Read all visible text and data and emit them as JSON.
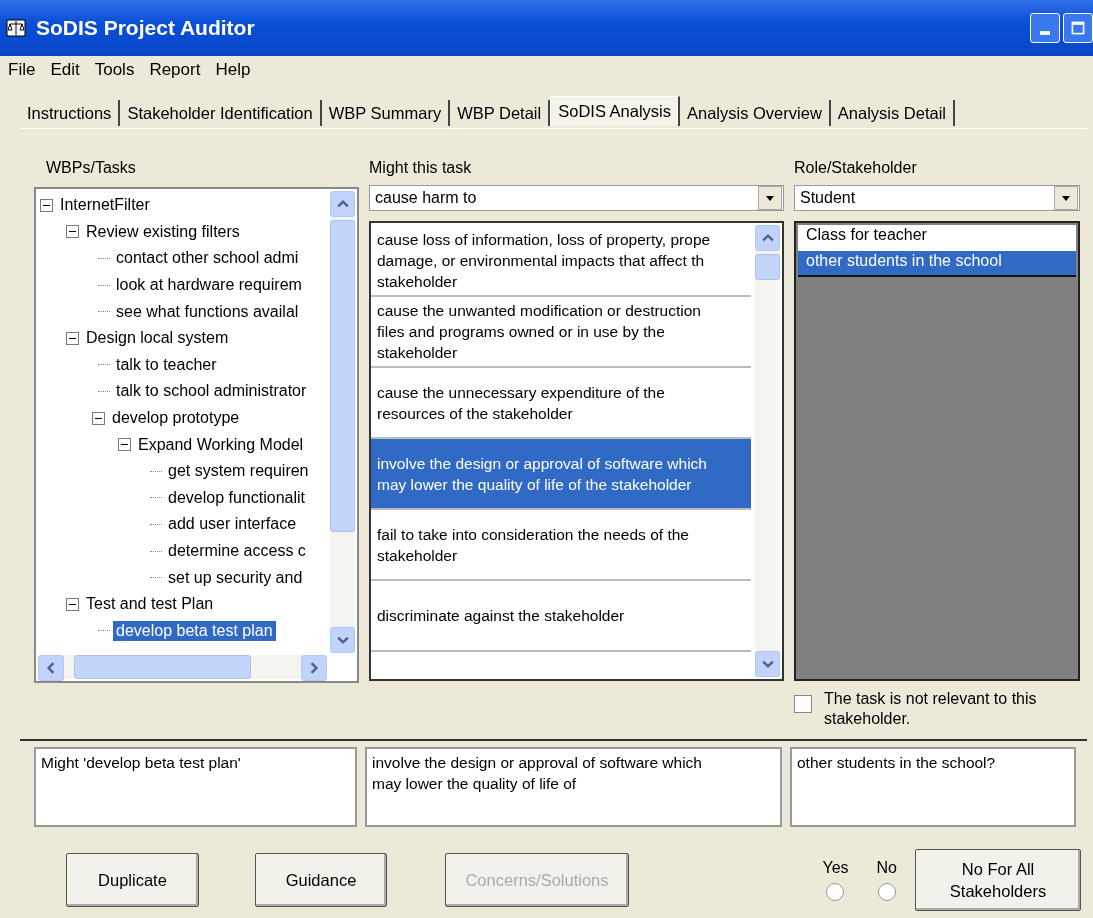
{
  "window": {
    "title": "SoDIS Project Auditor"
  },
  "menu": [
    "File",
    "Edit",
    "Tools",
    "Report",
    "Help"
  ],
  "tabs": [
    {
      "label": "Instructions",
      "selected": false
    },
    {
      "label": "Stakeholder Identification",
      "selected": false
    },
    {
      "label": "WBP Summary",
      "selected": false
    },
    {
      "label": "WBP Detail",
      "selected": false
    },
    {
      "label": "SoDIS Analysis",
      "selected": true
    },
    {
      "label": "Analysis Overview",
      "selected": false
    },
    {
      "label": "Analysis Detail",
      "selected": false
    }
  ],
  "tree": {
    "label": "WBPs/Tasks",
    "items": [
      {
        "label": "InternetFilter",
        "selected": false,
        "expanded": true,
        "children": [
          {
            "label": "Review existing filters",
            "selected": false,
            "expanded": true,
            "children": [
              {
                "label": "contact other school admi",
                "selected": false
              },
              {
                "label": "look at hardware requirem",
                "selected": false
              },
              {
                "label": "see what functions availal",
                "selected": false
              }
            ]
          },
          {
            "label": "Design local system",
            "selected": false,
            "expanded": true,
            "children": [
              {
                "label": "talk to teacher",
                "selected": false
              },
              {
                "label": "talk to school administrator",
                "selected": false
              },
              {
                "label": "develop prototype",
                "selected": false,
                "expanded": true,
                "children": [
                  {
                    "label": "Expand Working Model",
                    "selected": false,
                    "expanded": true,
                    "children": [
                      {
                        "label": "get system requiren",
                        "selected": false
                      },
                      {
                        "label": "develop functionalit",
                        "selected": false
                      },
                      {
                        "label": "add user interface",
                        "selected": false
                      },
                      {
                        "label": "determine access c",
                        "selected": false
                      },
                      {
                        "label": "set up security and",
                        "selected": false
                      }
                    ]
                  }
                ]
              }
            ]
          },
          {
            "label": "Test  and test Plan",
            "selected": false,
            "expanded": true,
            "children": [
              {
                "label": "develop beta test plan",
                "selected": true
              }
            ]
          }
        ]
      }
    ]
  },
  "harm": {
    "label": "Might this task",
    "value": "cause harm to",
    "items": [
      {
        "lines": [
          "cause loss of information, loss of property, prope",
          "damage, or environmental impacts that affect th",
          "stakeholder"
        ],
        "selected": false
      },
      {
        "lines": [
          "cause the unwanted modification or destruction",
          "files and programs owned or in use by the",
          "stakeholder"
        ],
        "selected": false
      },
      {
        "lines": [
          "cause the unnecessary expenditure of the",
          "resources of the stakeholder"
        ],
        "selected": false
      },
      {
        "lines": [
          "involve the design or approval of software which",
          "may lower the quality of life of the stakeholder"
        ],
        "selected": true
      },
      {
        "lines": [
          "fail to take into consideration the needs of the",
          "stakeholder"
        ],
        "selected": false
      },
      {
        "lines": [
          "discriminate against the stakeholder"
        ],
        "selected": false
      }
    ]
  },
  "stakeholder": {
    "label": "Role/Stakeholder",
    "value": "Student",
    "items": [
      {
        "label": "Class for teacher",
        "selected": false
      },
      {
        "label": "other students in the school",
        "selected": true
      }
    ],
    "not_relevant": {
      "label": "The task is not relevant to this stakeholder.",
      "checked": false
    }
  },
  "question": [
    "Might 'develop beta test plan'",
    "involve the design or approval of software which\nmay lower the quality of life of",
    "other students in the school?"
  ],
  "buttons": [
    {
      "label": "Duplicate",
      "disabled": false
    },
    {
      "label": "Guidance",
      "disabled": false
    },
    {
      "label": "Concerns/Solutions",
      "disabled": true
    }
  ],
  "answers": [
    {
      "label": "Yes",
      "selected": false
    },
    {
      "label": "No",
      "selected": false
    }
  ],
  "no_for_all": "No For All Stakeholders"
}
